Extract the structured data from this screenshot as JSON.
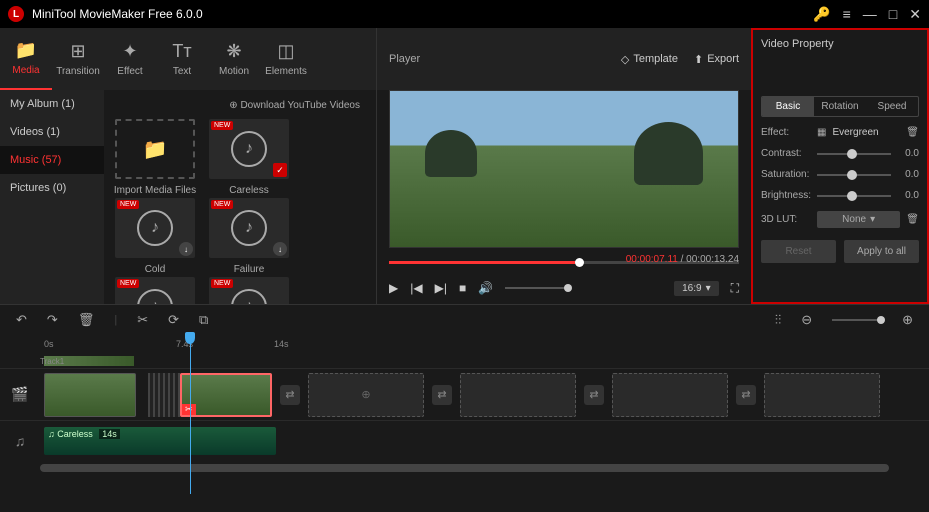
{
  "titlebar": {
    "title": "MiniTool MovieMaker Free 6.0.0",
    "logo_letter": "L"
  },
  "tabs": [
    {
      "icon": "📁",
      "label": "Media",
      "name": "tab-media"
    },
    {
      "icon": "⊞",
      "label": "Transition",
      "name": "tab-transition"
    },
    {
      "icon": "✦",
      "label": "Effect",
      "name": "tab-effect"
    },
    {
      "icon": "Tт",
      "label": "Text",
      "name": "tab-text"
    },
    {
      "icon": "❋",
      "label": "Motion",
      "name": "tab-motion"
    },
    {
      "icon": "◫",
      "label": "Elements",
      "name": "tab-elements"
    }
  ],
  "sidebar": {
    "items": [
      {
        "label": "My Album (1)",
        "name": "sidebar-myalbum"
      },
      {
        "label": "Videos (1)",
        "name": "sidebar-videos"
      },
      {
        "label": "Music (57)",
        "name": "sidebar-music"
      },
      {
        "label": "Pictures (0)",
        "name": "sidebar-pictures"
      }
    ],
    "download_label": "Download YouTube Videos"
  },
  "media": {
    "import_label": "Import Media Files",
    "items": [
      {
        "label": "Careless",
        "new": true,
        "checked": true
      },
      {
        "label": "Cold",
        "new": true,
        "dl": true
      },
      {
        "label": "Failure",
        "new": true,
        "dl": true
      },
      {
        "label": "",
        "new": true
      },
      {
        "label": "",
        "new": true
      }
    ]
  },
  "player": {
    "title": "Player",
    "template_label": "Template",
    "export_label": "Export",
    "current_time": "00:00:07.11",
    "total_time": "00:00:13.24",
    "aspect": "16:9"
  },
  "property": {
    "title": "Video Property",
    "tabs": {
      "basic": "Basic",
      "rotation": "Rotation",
      "speed": "Speed"
    },
    "effect_label": "Effect:",
    "effect_value": "Evergreen",
    "contrast_label": "Contrast:",
    "contrast_value": "0.0",
    "saturation_label": "Saturation:",
    "saturation_value": "0.0",
    "brightness_label": "Brightness:",
    "brightness_value": "0.0",
    "lut_label": "3D LUT:",
    "lut_value": "None",
    "reset_label": "Reset",
    "apply_label": "Apply to all"
  },
  "timeline": {
    "ruler_marks": [
      "0s",
      "7.4s",
      "14s"
    ],
    "track_label": "Track1",
    "audio_clip_label": "♫ Careless",
    "audio_clip_duration": "14s"
  }
}
